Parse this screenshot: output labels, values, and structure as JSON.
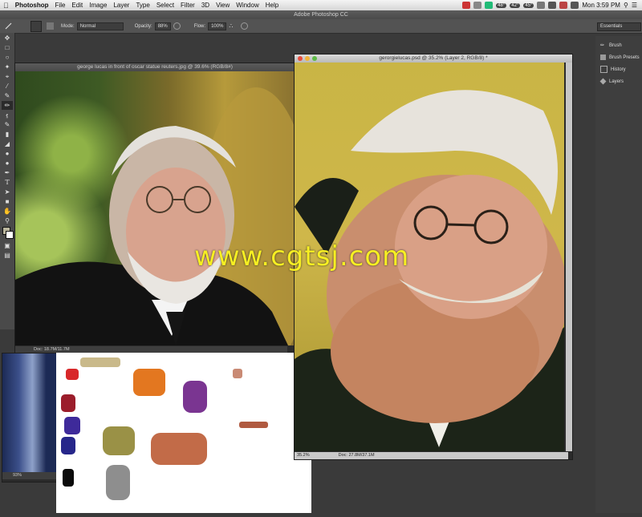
{
  "menubar": {
    "apple_icon": "apple-icon",
    "app_name": "Photoshop",
    "items": [
      "File",
      "Edit",
      "Image",
      "Layer",
      "Type",
      "Select",
      "Filter",
      "3D",
      "View",
      "Window",
      "Help"
    ],
    "tray": [
      "48°",
      "42°",
      "45°"
    ],
    "clock": "Mon 3:59 PM"
  },
  "app": {
    "title": "Adobe Photoshop CC"
  },
  "options_bar": {
    "mode_label": "Mode:",
    "mode_value": "Normal",
    "opacity_label": "Opacity:",
    "opacity_value": "88%",
    "flow_label": "Flow:",
    "flow_value": "100%"
  },
  "workspace": {
    "value": "Essentials"
  },
  "dock": {
    "items": [
      "Brush",
      "Brush Presets",
      "History",
      "Layers"
    ]
  },
  "doc1": {
    "title": "george lucas in front of oscar statue reuters.jpg @ 39.6% (RGB/8#)",
    "status": "Doc: 18.7M/11.7M"
  },
  "doc2": {
    "title": "gerorgielucas.psd @ 35.2% (Layer 2, RGB/8) *",
    "zoom": "35.2%",
    "status": "Doc: 27.8M/37.1M"
  },
  "doc3": {
    "zoom": "93%"
  },
  "watermark": "www.cgtsj.com",
  "colors": {
    "accent_yellow": "#f7ef22",
    "ps_panel": "#535353",
    "ps_bg": "#3a3a3a"
  }
}
